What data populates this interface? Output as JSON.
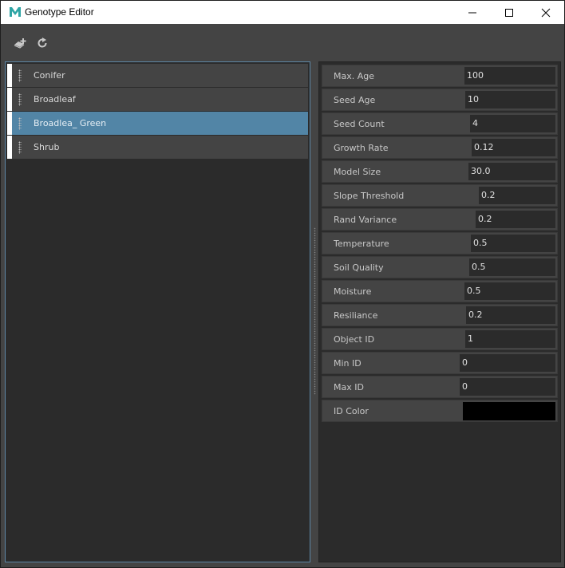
{
  "window": {
    "title": "Genotype Editor",
    "app_icon": "maya-m-icon",
    "controls": [
      "minimize",
      "maximize",
      "close"
    ]
  },
  "toolbar": {
    "buttons": [
      {
        "icon": "add-genotype-icon",
        "tooltip": ""
      },
      {
        "icon": "refresh-icon",
        "tooltip": ""
      }
    ]
  },
  "genotypes": {
    "selected_index": 2,
    "items": [
      {
        "label": "Conifer",
        "color": "#ffffff"
      },
      {
        "label": "Broadleaf",
        "color": "#ffffff"
      },
      {
        "label": "Broadlea_ Green",
        "color": "#ffffff"
      },
      {
        "label": "Shrub",
        "color": "#ffffff"
      }
    ]
  },
  "attributes": [
    {
      "label": "Max. Age",
      "value": "100"
    },
    {
      "label": "Seed Age",
      "value": "10"
    },
    {
      "label": "Seed Count",
      "value": "4"
    },
    {
      "label": "Growth Rate",
      "value": "0.12"
    },
    {
      "label": "Model Size",
      "value": "30.0"
    },
    {
      "label": "Slope Threshold",
      "value": "0.2"
    },
    {
      "label": "Rand Variance",
      "value": "0.2"
    },
    {
      "label": "Temperature",
      "value": "0.5"
    },
    {
      "label": "Soil Quality",
      "value": "0.5"
    },
    {
      "label": "Moisture",
      "value": "0.5"
    },
    {
      "label": "Resiliance",
      "value": "0.2"
    },
    {
      "label": "Object ID",
      "value": "1"
    },
    {
      "label": "Min ID",
      "value": "0"
    },
    {
      "label": "Max ID",
      "value": "0"
    }
  ],
  "id_color": {
    "label": "ID Color",
    "value": "#000000"
  },
  "colors": {
    "selection": "#5285a6",
    "panel_border_active": "#5e87a6",
    "background": "#444444",
    "panel_bg": "#2b2b2b"
  }
}
